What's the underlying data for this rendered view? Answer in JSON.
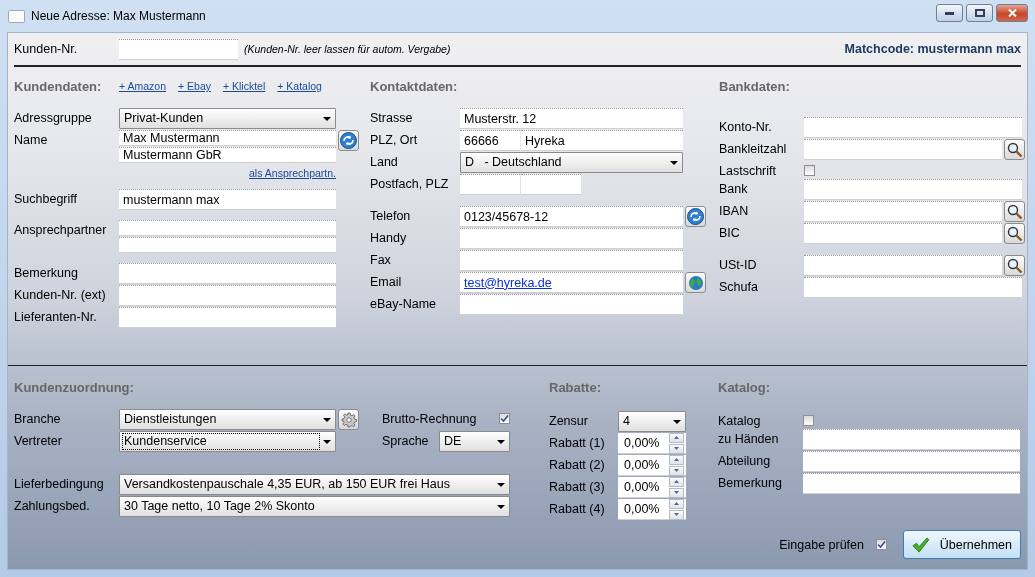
{
  "window": {
    "title": "Neue Adresse: Max Mustermann"
  },
  "customer_number": {
    "label": "Kunden-Nr.",
    "hint": "(Kunden-Nr. leer lassen für autom. Vergabe)"
  },
  "matchcode": "Matchcode: mustermann max",
  "kundendaten": {
    "heading": "Kundendaten:",
    "links": [
      "+ Amazon",
      "+ Ebay",
      "+ Klicktel",
      "+ Katalog"
    ],
    "groups": [
      [
        {
          "label": "Adressgruppe",
          "fields": [
            {
              "kind": "select",
              "value": "Privat-Kunden"
            }
          ]
        },
        {
          "label": "Name",
          "fields": [
            {
              "kind": "input",
              "value": "Max Mustermann"
            },
            {
              "kind": "input",
              "value": "Mustermann GbR"
            }
          ],
          "button": {
            "kind": "sync"
          },
          "link": "als Ansprechpartn."
        }
      ],
      [
        {
          "label": "Suchbegriff",
          "fields": [
            {
              "kind": "input",
              "value": "mustermann max"
            }
          ]
        }
      ],
      [
        {
          "label": "Ansprechpartner",
          "fields": [
            {
              "kind": "input"
            },
            {
              "kind": "input"
            }
          ]
        }
      ],
      [
        {
          "label": "Bemerkung",
          "fields": [
            {
              "kind": "input"
            }
          ]
        },
        {
          "label": "Kunden-Nr. (ext)",
          "fields": [
            {
              "kind": "input"
            }
          ]
        },
        {
          "label": "Lieferanten-Nr.",
          "fields": [
            {
              "kind": "input"
            }
          ]
        }
      ]
    ]
  },
  "kontaktdaten": {
    "heading": "Kontaktdaten:",
    "groups": [
      [
        {
          "label": "Strasse",
          "fields": [
            {
              "kind": "input",
              "value": "Musterstr. 12"
            }
          ]
        },
        {
          "label": "PLZ, Ort",
          "fields": [
            {
              "kind": "short",
              "value": "66666"
            },
            {
              "kind": "input",
              "value": "Hyreka"
            }
          ]
        },
        {
          "label": "Land",
          "fields": [
            {
              "kind": "select",
              "value": "D   - Deutschland"
            }
          ]
        },
        {
          "label": "Postfach, PLZ",
          "fields": [
            {
              "kind": "short"
            },
            {
              "kind": "short"
            }
          ]
        }
      ],
      [
        {
          "label": "Telefon",
          "fields": [
            {
              "kind": "input",
              "value": "0123/45678-12"
            }
          ],
          "button": {
            "kind": "sync"
          }
        },
        {
          "label": "Handy",
          "fields": [
            {
              "kind": "input"
            }
          ]
        },
        {
          "label": "Fax",
          "fields": [
            {
              "kind": "input"
            }
          ]
        },
        {
          "label": "Email",
          "fields": [
            {
              "kind": "link",
              "value": "test@hyreka.de"
            }
          ],
          "button": {
            "kind": "globe"
          }
        },
        {
          "label": "eBay-Name",
          "fields": [
            {
              "kind": "input"
            }
          ]
        }
      ]
    ]
  },
  "bankdaten": {
    "heading": "Bankdaten:",
    "groups": [
      [
        {
          "label": "Konto-Nr.",
          "fields": [
            {
              "kind": "input"
            }
          ]
        },
        {
          "label": "Bankleitzahl",
          "fields": [
            {
              "kind": "input"
            }
          ],
          "button": {
            "kind": "search"
          }
        },
        {
          "label": "Lastschrift",
          "fields": [
            {
              "kind": "checkbox",
              "checked": false
            }
          ]
        },
        {
          "label": "Bank",
          "fields": [
            {
              "kind": "input"
            }
          ]
        },
        {
          "label": "IBAN",
          "fields": [
            {
              "kind": "input"
            }
          ],
          "button": {
            "kind": "search"
          }
        },
        {
          "label": "BIC",
          "fields": [
            {
              "kind": "input"
            }
          ],
          "button": {
            "kind": "search"
          }
        }
      ],
      [
        {
          "label": "USt-ID",
          "fields": [
            {
              "kind": "input"
            }
          ],
          "button": {
            "kind": "search"
          }
        },
        {
          "label": "Schufa",
          "fields": [
            {
              "kind": "input"
            }
          ]
        }
      ]
    ]
  },
  "kundenzuordnung": {
    "heading": "Kundenzuordnung:",
    "groups": [
      [
        {
          "label": "Branche",
          "fields": [
            {
              "kind": "select",
              "value": "Dienstleistungen",
              "focused": false
            }
          ],
          "button": {
            "kind": "gear"
          },
          "side": {
            "label": "Brutto-Rechnung",
            "fields": [
              {
                "kind": "checkbox",
                "checked": true
              }
            ]
          }
        },
        {
          "label": "Vertreter",
          "fields": [
            {
              "kind": "select",
              "value": "Kundenservice",
              "focused": true
            }
          ],
          "side": {
            "label": "Sprache",
            "fields": [
              {
                "kind": "select",
                "value": "DE",
                "focused": false
              }
            ]
          }
        }
      ],
      [
        {
          "label": "Lieferbedingung",
          "fields": [
            {
              "kind": "select",
              "value": "Versandkostenpauschale 4,35 EUR, ab 150 EUR frei Haus",
              "focused": false
            }
          ]
        },
        {
          "label": "Zahlungsbed.",
          "fields": [
            {
              "kind": "select",
              "value": "30 Tage netto, 10 Tage 2% Skonto",
              "focused": false
            }
          ]
        }
      ]
    ]
  },
  "rabatte": {
    "heading": "Rabatte:",
    "groups": [
      [
        {
          "label": "Zensur",
          "fields": [
            {
              "kind": "select",
              "value": "4"
            }
          ]
        },
        {
          "label": "Rabatt (1)",
          "fields": [
            {
              "kind": "spin",
              "value": "0,00%"
            }
          ]
        },
        {
          "label": "Rabatt (2)",
          "fields": [
            {
              "kind": "spin",
              "value": "0,00%"
            }
          ]
        },
        {
          "label": "Rabatt (3)",
          "fields": [
            {
              "kind": "spin",
              "value": "0,00%"
            }
          ]
        },
        {
          "label": "Rabatt (4)",
          "fields": [
            {
              "kind": "spin",
              "value": "0,00%"
            }
          ]
        }
      ]
    ]
  },
  "katalog": {
    "heading": "Katalog:",
    "groups": [
      [
        {
          "label": "Katalog",
          "fields": [
            {
              "kind": "checkbox",
              "checked": false
            }
          ]
        },
        {
          "label": "zu Händen",
          "fields": [
            {
              "kind": "input"
            }
          ]
        },
        {
          "label": "Abteilung",
          "fields": [
            {
              "kind": "input"
            }
          ]
        },
        {
          "label": "Bemerkung",
          "fields": [
            {
              "kind": "input"
            }
          ]
        }
      ]
    ]
  },
  "footer": {
    "check_label": "Eingabe prüfen",
    "checked": true,
    "button": "Übernehmen"
  }
}
